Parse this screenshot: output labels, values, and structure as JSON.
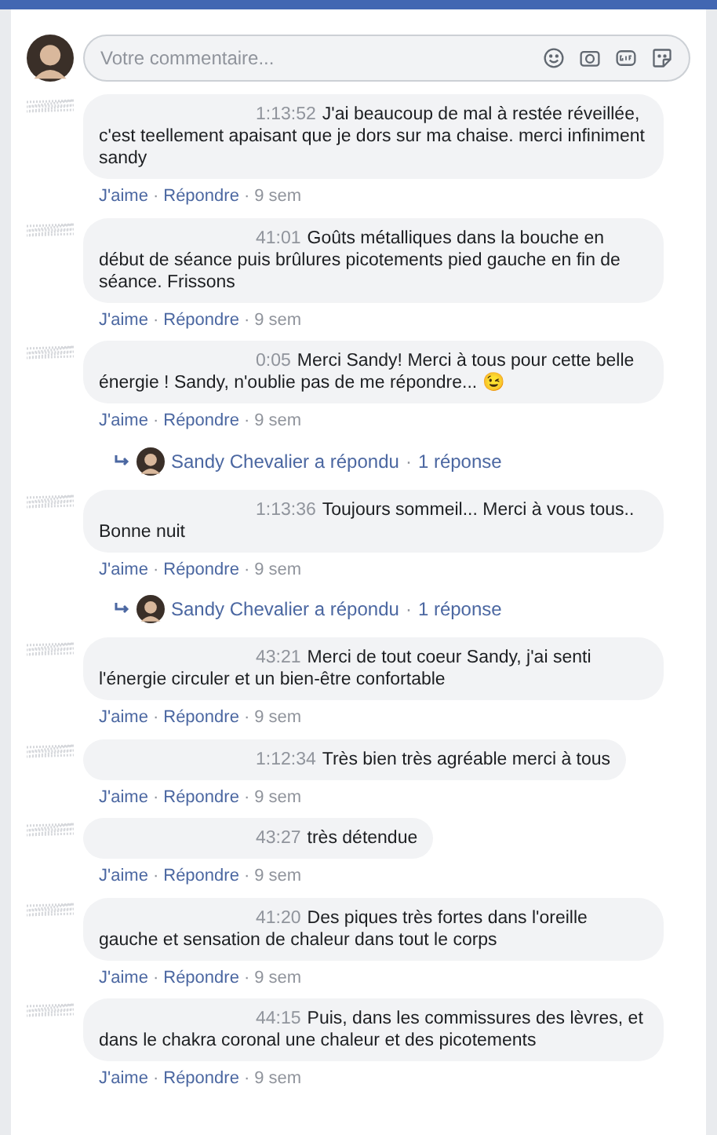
{
  "comment_box": {
    "placeholder": "Votre commentaire..."
  },
  "separator": "·",
  "comments": [
    {
      "timestamp": "1:13:52",
      "text": "J'ai beaucoup de mal à restée réveillée, c'est teellement apaisant que je dors sur ma chaise. merci infiniment sandy",
      "like": "J'aime",
      "reply": "Répondre",
      "age": "9 sem"
    },
    {
      "timestamp": "41:01",
      "text": "Goûts métalliques dans la bouche en début de séance puis brûlures picotements pied gauche en fin de séance. Frissons",
      "like": "J'aime",
      "reply": "Répondre",
      "age": "9 sem"
    },
    {
      "timestamp": "0:05",
      "text": "Merci Sandy! Merci à tous pour cette belle énergie ! Sandy, n'oublie pas de me répondre... 😉",
      "like": "J'aime",
      "reply": "Répondre",
      "age": "9 sem",
      "replies": {
        "text": "Sandy Chevalier a répondu",
        "count": "1 réponse"
      }
    },
    {
      "timestamp": "1:13:36",
      "text": "Toujours sommeil... Merci à vous tous.. Bonne nuit",
      "like": "J'aime",
      "reply": "Répondre",
      "age": "9 sem",
      "replies": {
        "text": "Sandy Chevalier a répondu",
        "count": "1 réponse"
      }
    },
    {
      "timestamp": "43:21",
      "text": "Merci de tout coeur Sandy, j'ai senti l'énergie circuler et un bien-être confortable",
      "like": "J'aime",
      "reply": "Répondre",
      "age": "9 sem"
    },
    {
      "timestamp": "1:12:34",
      "text": "Très bien très agréable merci à tous",
      "like": "J'aime",
      "reply": "Répondre",
      "age": "9 sem"
    },
    {
      "timestamp": "43:27",
      "text": "très détendue",
      "like": "J'aime",
      "reply": "Répondre",
      "age": "9 sem"
    },
    {
      "timestamp": "41:20",
      "text": "Des piques très fortes dans l'oreille gauche et sensation de chaleur dans tout le corps",
      "like": "J'aime",
      "reply": "Répondre",
      "age": "9 sem"
    },
    {
      "timestamp": "44:15",
      "text": "Puis, dans les commissures des lèvres, et dans le chakra coronal une chaleur et des picotements",
      "like": "J'aime",
      "reply": "Répondre",
      "age": "9 sem"
    }
  ]
}
